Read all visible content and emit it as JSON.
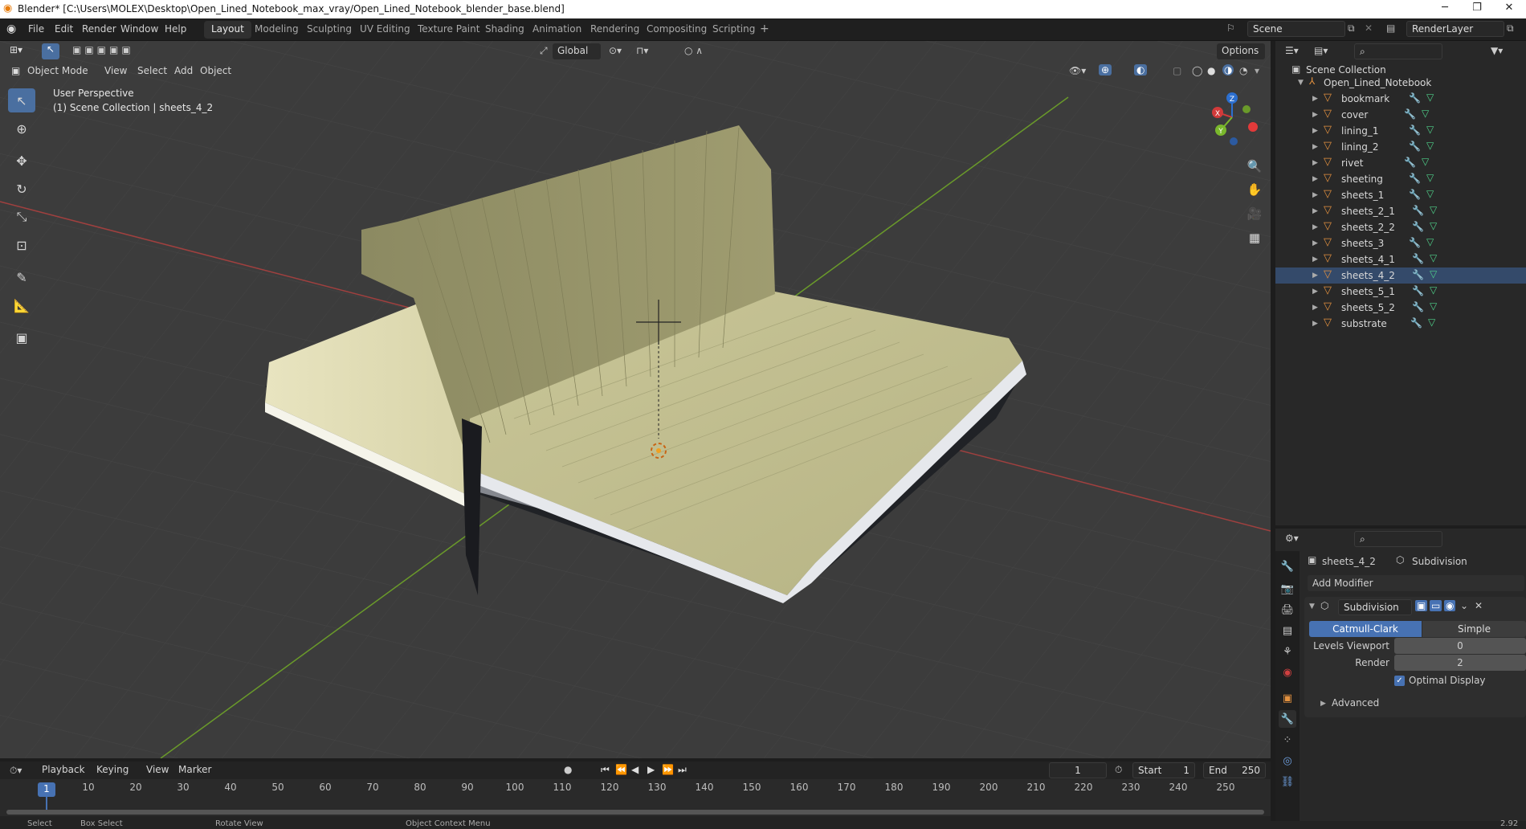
{
  "title_bar": {
    "title": "Blender* [C:\\Users\\MOLEX\\Desktop\\Open_Lined_Notebook_max_vray/Open_Lined_Notebook_blender_base.blend]"
  },
  "menu": {
    "items": [
      "File",
      "Edit",
      "Render",
      "Window",
      "Help"
    ]
  },
  "workspaces": [
    "Layout",
    "Modeling",
    "Sculpting",
    "UV Editing",
    "Texture Paint",
    "Shading",
    "Animation",
    "Rendering",
    "Compositing",
    "Scripting"
  ],
  "active_workspace": "Layout",
  "scene": {
    "scene_name": "Scene",
    "render_layer": "RenderLayer"
  },
  "viewport": {
    "mode": "Object Mode",
    "menus": [
      "View",
      "Select",
      "Add",
      "Object"
    ],
    "transform_orientation": "Global",
    "options_label": "Options",
    "perspective_label": "User Perspective",
    "collection_label": "(1) Scene Collection | sheets_4_2",
    "gizmo": {
      "x": "X",
      "y": "Y",
      "z": "Z"
    }
  },
  "outliner": {
    "root": "Scene Collection",
    "collection": "Open_Lined_Notebook",
    "objects": [
      "bookmark",
      "cover",
      "lining_1",
      "lining_2",
      "rivet",
      "sheeting",
      "sheets_1",
      "sheets_2_1",
      "sheets_2_2",
      "sheets_3",
      "sheets_4_1",
      "sheets_4_2",
      "sheets_5_1",
      "sheets_5_2",
      "substrate"
    ],
    "selected": "sheets_4_2"
  },
  "properties": {
    "object_name": "sheets_4_2",
    "modifier_tab": "Subdivision",
    "add_modifier_label": "Add Modifier",
    "modifier_name": "Subdivision",
    "type_catmull": "Catmull-Clark",
    "type_simple": "Simple",
    "levels_viewport_label": "Levels Viewport",
    "levels_viewport_value": "0",
    "render_label": "Render",
    "render_value": "2",
    "optimal_display_label": "Optimal Display",
    "optimal_display_checked": true,
    "advanced_label": "Advanced"
  },
  "timeline": {
    "menus": [
      "Playback",
      "Keying",
      "View",
      "Marker"
    ],
    "current_frame": "1",
    "start_label": "Start",
    "start_value": "1",
    "end_label": "End",
    "end_value": "250",
    "ruler": [
      "10",
      "20",
      "30",
      "40",
      "50",
      "60",
      "70",
      "80",
      "90",
      "100",
      "110",
      "120",
      "130",
      "140",
      "150",
      "160",
      "170",
      "180",
      "190",
      "200",
      "210",
      "220",
      "230",
      "240",
      "250"
    ],
    "playhead": "1"
  },
  "statusbar": {
    "items": [
      "Select",
      "Box Select",
      "Rotate View",
      "Object Context Menu"
    ],
    "version": "2.92"
  },
  "colors": {
    "accent": "#4772b3",
    "selected_row": "#344a6a",
    "viewport_bg": "#3c3c3c",
    "object_icon": "#e3913f",
    "mesh_icon": "#4fd18a"
  }
}
